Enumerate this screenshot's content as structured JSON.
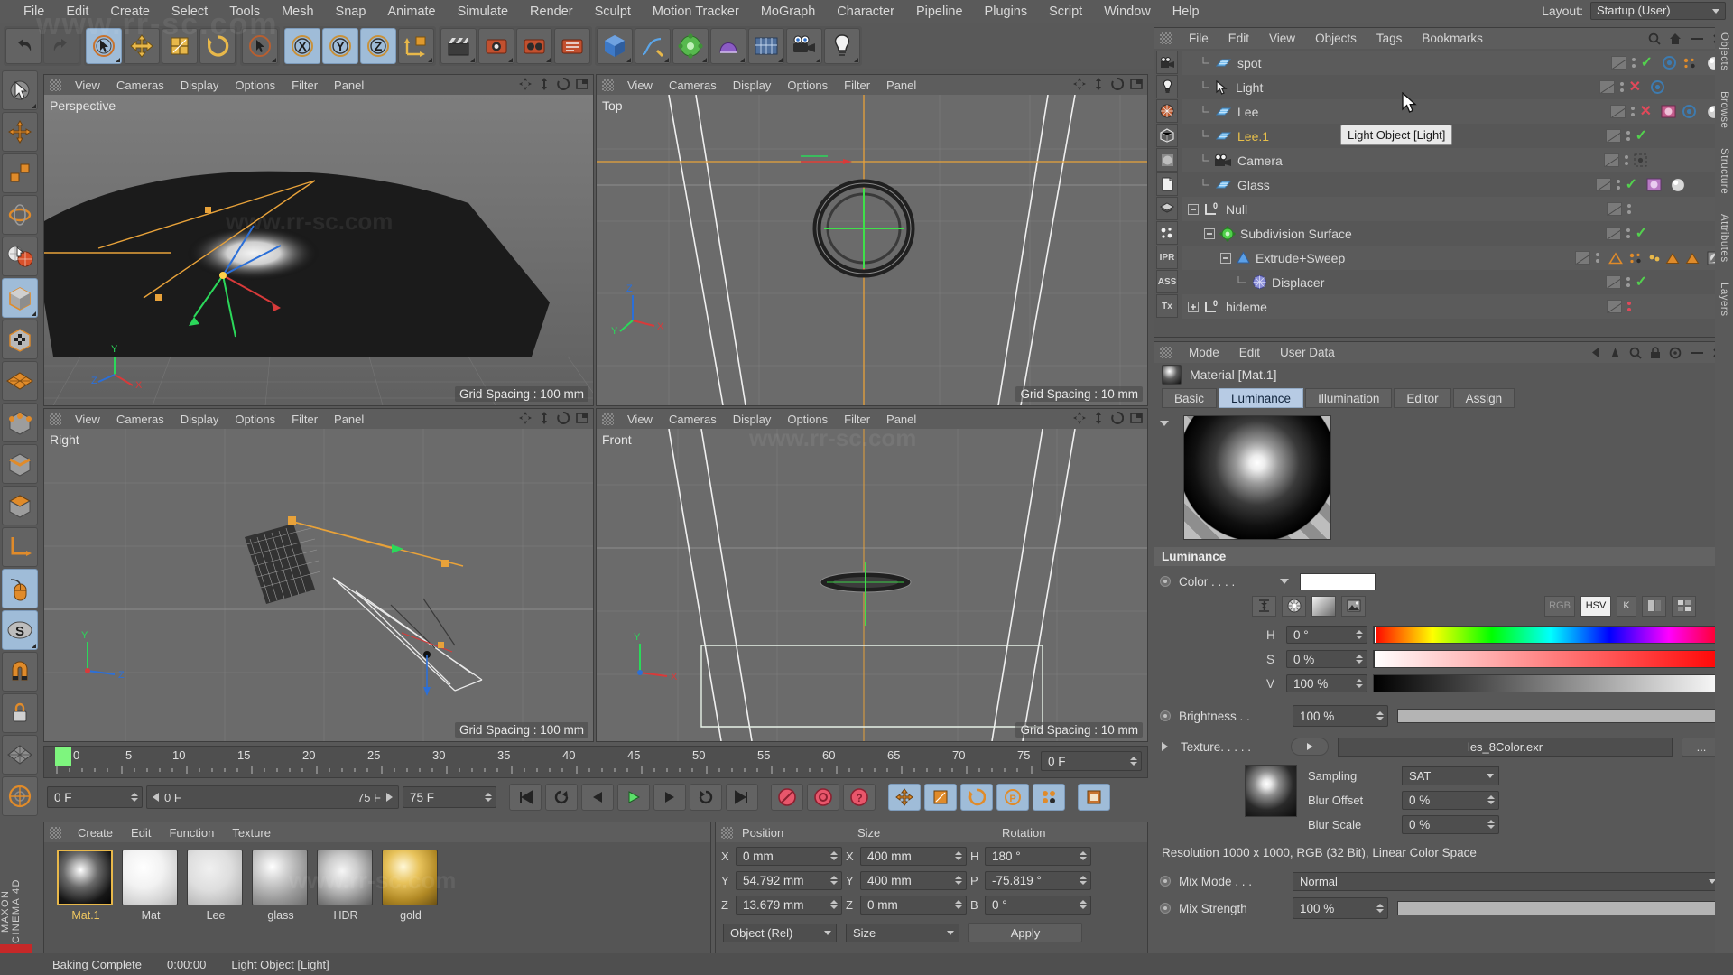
{
  "app": {
    "name": "MAXON CINEMA 4D"
  },
  "menubar": {
    "items": [
      "File",
      "Edit",
      "Create",
      "Select",
      "Tools",
      "Mesh",
      "Snap",
      "Animate",
      "Simulate",
      "Render",
      "Sculpt",
      "Motion Tracker",
      "MoGraph",
      "Character",
      "Pipeline",
      "Plugins",
      "Script",
      "Window",
      "Help"
    ],
    "layout_label": "Layout:",
    "layout_value": "Startup (User)"
  },
  "toolbar": {
    "groups": [
      {
        "buttons": [
          {
            "icon": "undo-icon",
            "selected": false
          }
        ]
      },
      {
        "buttons": [
          {
            "icon": "select-live-icon",
            "selected": true
          },
          {
            "icon": "move-icon",
            "selected": false
          },
          {
            "icon": "scale-icon",
            "selected": false
          },
          {
            "icon": "rotate-icon",
            "selected": false
          }
        ]
      },
      {
        "buttons": [
          {
            "icon": "select-cursor-icon",
            "selected": false
          }
        ]
      },
      {
        "buttons": [
          {
            "icon": "axis-x-icon",
            "selected": true,
            "label": "X"
          },
          {
            "icon": "axis-y-icon",
            "selected": true,
            "label": "Y"
          },
          {
            "icon": "axis-z-icon",
            "selected": true,
            "label": "Z"
          },
          {
            "icon": "world-axis-icon",
            "selected": false
          }
        ]
      },
      {
        "buttons": [
          {
            "icon": "clapperboard-icon",
            "selected": false
          },
          {
            "icon": "render-view-icon",
            "selected": false
          },
          {
            "icon": "render-picture-viewer-icon",
            "selected": false
          },
          {
            "icon": "render-settings-icon",
            "selected": false
          }
        ]
      },
      {
        "buttons": [
          {
            "icon": "cube-primitive-icon",
            "selected": false
          },
          {
            "icon": "spline-pen-icon",
            "selected": false
          },
          {
            "icon": "generator-icon",
            "selected": false
          },
          {
            "icon": "deformer-icon",
            "selected": false
          },
          {
            "icon": "scene-environment-icon",
            "selected": false
          },
          {
            "icon": "camera-icon",
            "selected": false
          },
          {
            "icon": "light-icon",
            "selected": false
          }
        ]
      }
    ]
  },
  "left_toolbar": {
    "items": [
      {
        "icon": "live-selection-icon",
        "selected": false
      },
      {
        "icon": "move-tool-icon",
        "selected": false
      },
      {
        "icon": "scale-tool-icon",
        "selected": false
      },
      {
        "icon": "rotate-tool-icon",
        "selected": false
      },
      {
        "icon": "make-editable-icon",
        "selected": false
      },
      {
        "icon": "model-mode-icon",
        "selected": true
      },
      {
        "icon": "texture-mode-icon",
        "selected": false
      },
      {
        "icon": "polygon-mode-icon",
        "selected": false
      },
      {
        "icon": "point-mode-icon",
        "selected": false
      },
      {
        "icon": "edge-mode-icon",
        "selected": false
      },
      {
        "icon": "object-axis-icon",
        "selected": false
      },
      {
        "icon": "world-object-coordinates-icon",
        "selected": false
      },
      {
        "icon": "viewport-solo-icon",
        "selected": true
      },
      {
        "icon": "snap-icon",
        "selected": true
      },
      {
        "icon": "magnet-icon",
        "selected": false
      },
      {
        "icon": "workplane-lock-icon",
        "selected": false
      },
      {
        "icon": "grid-icon",
        "selected": false
      },
      {
        "icon": "quantize-icon",
        "selected": false
      }
    ]
  },
  "viewports": {
    "menu": [
      "View",
      "Cameras",
      "Display",
      "Options",
      "Filter",
      "Panel"
    ],
    "panels": [
      {
        "name": "Perspective",
        "grid": "Grid Spacing : 100 mm"
      },
      {
        "name": "Top",
        "grid": "Grid Spacing : 10 mm"
      },
      {
        "name": "Right",
        "grid": "Grid Spacing : 100 mm"
      },
      {
        "name": "Front",
        "grid": "Grid Spacing : 10 mm"
      }
    ]
  },
  "timeline": {
    "ticks": [
      0,
      5,
      10,
      15,
      20,
      25,
      30,
      35,
      40,
      45,
      50,
      55,
      60,
      65,
      70,
      75
    ],
    "current_frame_field": "0 F",
    "green_marker_frame": 0
  },
  "transport": {
    "frame_start": "0 F",
    "frame_left": "0 F",
    "frame_right": "75 F",
    "frame_end": "75 F",
    "buttons": [
      "go-to-start-icon",
      "play-backwards-loop-icon",
      "step-back-icon",
      "play-icon",
      "step-forward-icon",
      "loop-icon",
      "go-to-end-icon",
      "record-active-objects-icon",
      "autokeying-icon",
      "keyframe-selection-icon",
      "position-key-icon",
      "scale-key-icon",
      "rotation-key-icon",
      "param-key-icon",
      "point-level-animation-icon",
      "timeline-icon"
    ]
  },
  "material_manager": {
    "menu": [
      "Create",
      "Edit",
      "Function",
      "Texture"
    ],
    "materials": [
      {
        "name": "Mat.1",
        "selected": true,
        "type": "luminance-sphere"
      },
      {
        "name": "Mat",
        "selected": false,
        "type": "white-sphere"
      },
      {
        "name": "Lee",
        "selected": false,
        "type": "flat-sphere"
      },
      {
        "name": "glass",
        "selected": false,
        "type": "glass-sphere"
      },
      {
        "name": "HDR",
        "selected": false,
        "type": "hdr-sphere"
      },
      {
        "name": "gold",
        "selected": false,
        "type": "gold-sphere"
      }
    ]
  },
  "coordinates": {
    "headers": [
      "Position",
      "Size",
      "Rotation"
    ],
    "rows": [
      {
        "axis": "X",
        "position": "0 mm",
        "size": "400 mm",
        "rot_label": "H",
        "rotation": "180 °"
      },
      {
        "axis": "Y",
        "position": "54.792 mm",
        "size": "400 mm",
        "rot_label": "P",
        "rotation": "-75.819 °"
      },
      {
        "axis": "Z",
        "position": "13.679 mm",
        "size": "0 mm",
        "rot_label": "B",
        "rotation": "0 °"
      }
    ],
    "object_mode": "Object (Rel)",
    "size_mode": "Size",
    "apply_label": "Apply"
  },
  "object_manager": {
    "menu": [
      "File",
      "Edit",
      "View",
      "Objects",
      "Tags",
      "Bookmarks"
    ],
    "sidebar_icons": [
      "camera-icon",
      "light-icon",
      "sky-icon",
      "environment-icon",
      "material-icon",
      "file-icon",
      "layer-icon",
      "particle-icon",
      "IPR",
      "ASS",
      "Tx"
    ],
    "tooltip": "Light Object [Light]",
    "rows": [
      {
        "name": "spot",
        "icon": "light-plane-icon",
        "indent": 1,
        "selected": false,
        "visibility": "check",
        "dots": "gray"
      },
      {
        "name": "Light",
        "icon": "cursor-light-icon",
        "indent": 1,
        "selected": false,
        "visibility": "x",
        "dots": "gray"
      },
      {
        "name": "Lee",
        "icon": "light-plane-icon",
        "indent": 1,
        "selected": false,
        "visibility": "x",
        "dots": "gray",
        "extra_tags": [
          "material-tag",
          "target-tag",
          "sphere-tag"
        ]
      },
      {
        "name": "Lee.1",
        "icon": "light-plane-icon",
        "indent": 1,
        "selected": true,
        "visibility": "check",
        "dots": "gray"
      },
      {
        "name": "Camera",
        "icon": "camera-icon",
        "indent": 1,
        "selected": false,
        "visibility": "dashed",
        "dots": "gray"
      },
      {
        "name": "Glass",
        "icon": "light-plane-icon",
        "indent": 1,
        "selected": false,
        "visibility": "check",
        "dots": "gray",
        "extra_tags": [
          "material-tag",
          "sphere-tag"
        ]
      },
      {
        "name": "Null",
        "icon": "null-icon",
        "indent": 0,
        "selected": false,
        "visibility": "none",
        "dots": "gray",
        "expandable": true
      },
      {
        "name": "Subdivision Surface",
        "icon": "subdivision-icon",
        "indent": 1,
        "selected": false,
        "visibility": "check",
        "dots": "gray",
        "expandable": true
      },
      {
        "name": "Extrude+Sweep",
        "icon": "sweep-icon",
        "indent": 2,
        "selected": false,
        "visibility": "none",
        "dots": "gray",
        "extra_tags": [
          "tri-tag",
          "mograph-tag",
          "dot-tag",
          "tri-orange-tag",
          "tri-orange2-tag",
          "texture-tag"
        ],
        "expandable": true
      },
      {
        "name": "Displacer",
        "icon": "displacer-icon",
        "indent": 3,
        "selected": false,
        "visibility": "check",
        "dots": "gray"
      },
      {
        "name": "hideme",
        "icon": "null-icon",
        "indent": 0,
        "selected": false,
        "visibility": "none",
        "dots": "red",
        "expandable": true
      }
    ]
  },
  "attributes": {
    "menu": [
      "Mode",
      "Edit",
      "User Data"
    ],
    "object_title": "Material [Mat.1]",
    "tabs": [
      {
        "label": "Basic",
        "active": false
      },
      {
        "label": "Luminance",
        "active": true
      },
      {
        "label": "Illumination",
        "active": false
      },
      {
        "label": "Editor",
        "active": false
      },
      {
        "label": "Assign",
        "active": false
      }
    ],
    "section_title": "Luminance",
    "color": {
      "label": "Color . . . .",
      "swatch_hex": "#ffffff",
      "mode_buttons": [
        "eyedropper-range-icon",
        "color-wheel-icon",
        "gradient-icon",
        "image-icon"
      ],
      "space_buttons": [
        "RGB",
        "HSV",
        "K",
        "mixer-icon",
        "presets-icon"
      ],
      "active_space": "HSV",
      "picker_icon": "eyedropper-icon",
      "channels": [
        {
          "label": "H",
          "value": "0 °"
        },
        {
          "label": "S",
          "value": "0 %"
        },
        {
          "label": "V",
          "value": "100 %"
        }
      ]
    },
    "brightness": {
      "label": "Brightness . .",
      "value": "100 %"
    },
    "texture": {
      "label": "Texture. . . . .",
      "value": "les_8Color.exr",
      "browse_label": "..."
    },
    "sampling": {
      "label": "Sampling",
      "value": "SAT"
    },
    "blur_offset": {
      "label": "Blur Offset",
      "value": "0 %"
    },
    "blur_scale": {
      "label": "Blur Scale",
      "value": "0 %"
    },
    "resolution_text": "Resolution 1000 x 1000, RGB (32 Bit), Linear Color Space",
    "mix_mode": {
      "label": "Mix Mode . . .",
      "value": "Normal"
    },
    "mix_strength": {
      "label": "Mix Strength",
      "value": "100 %"
    }
  },
  "right_rail": {
    "labels": [
      "Objects",
      "Browse",
      "Structure",
      "Attributes",
      "Layers"
    ]
  },
  "status": {
    "segments": [
      "Baking Complete",
      "0:00:00",
      "Light Object [Light]"
    ]
  },
  "watermark": {
    "text": "www.rr-sc.com"
  },
  "colors": {
    "accent_blue": "#9fbcd8",
    "selection_yellow": "#e8c04a",
    "green_check": "#53d14e",
    "red_x": "#e2495a",
    "panel_bg": "#585858",
    "viewport_bg": "#6b6b6b"
  }
}
